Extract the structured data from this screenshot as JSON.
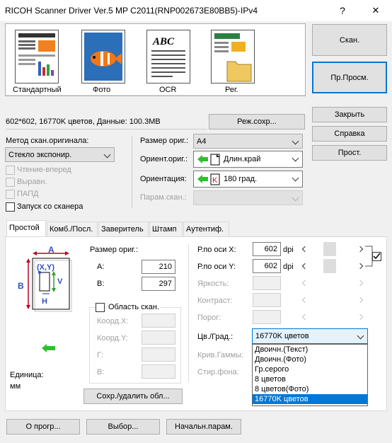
{
  "window": {
    "title": "RICOH Scanner Driver Ver.5 MP C2011(RNP002673E80BB5)-IPv4",
    "help_btn": "?",
    "close_btn": "✕"
  },
  "presets": [
    {
      "label": "Стандартный",
      "icon": "newspaper-icon"
    },
    {
      "label": "Фото",
      "icon": "fish-photo-icon"
    },
    {
      "label": "OCR",
      "icon": "text-document-icon"
    },
    {
      "label": "Рег.",
      "icon": "folder-document-icon"
    }
  ],
  "info_text": "602*602, 16770K цветов, Данные: 100.3MB",
  "save_mode_button": "Реж.сохр...",
  "right_buttons": {
    "scan": "Скан.",
    "preview": "Пр.Просм.",
    "close": "Закрыть",
    "help": "Справка",
    "simple": "Прост."
  },
  "scan_method": {
    "label": "Метод скан.оригинала:",
    "value": "Стекло экспонир."
  },
  "checkboxes": [
    {
      "label": "Чтение-вперед",
      "enabled": false
    },
    {
      "label": "Выравн.",
      "enabled": false
    },
    {
      "label": "ПАПД",
      "enabled": false
    },
    {
      "label": "Запуск со сканера",
      "enabled": true
    }
  ],
  "orig_size": {
    "label": "Размер ориг.:",
    "value": "A4"
  },
  "orig_orient": {
    "label": "Ориент.ориг.:",
    "value": "Длин.край"
  },
  "orientation": {
    "label": "Ориентация:",
    "value": "180 град."
  },
  "scan_param": {
    "label": "Парам.скан.:"
  },
  "tabs": [
    "Простой",
    "Комб./Посл.",
    "Заверитель",
    "Штамп",
    "Аутентиф."
  ],
  "diagram": {
    "a": "A",
    "b": "B",
    "xy": "(X,Y)",
    "v": "V",
    "h": "H"
  },
  "unit": {
    "label": "Единица:",
    "value": "мм"
  },
  "size_section": {
    "title": "Размер ориг.:",
    "a_label": "A:",
    "a_value": "210",
    "b_label": "B:",
    "b_value": "297"
  },
  "scan_area": {
    "label": "Область скан.",
    "x_label": "Коорд.X:",
    "y_label": "Коорд.Y:",
    "g_label": "Г:",
    "v_label": "В:"
  },
  "save_area_button": "Сохр./удалить обл...",
  "res_x": {
    "label": "Р.по оси X:",
    "value": "602",
    "unit": "dpi"
  },
  "res_y": {
    "label": "Р.по оси Y:",
    "value": "602",
    "unit": "dpi"
  },
  "brightness": {
    "label": "Яркость:"
  },
  "contrast": {
    "label": "Контраст:"
  },
  "threshold": {
    "label": "Порог:"
  },
  "color": {
    "label": "Цв./Град.:",
    "value": "16770K цветов"
  },
  "gamma": {
    "label": "Крив.Гаммы:"
  },
  "erase": {
    "label": "Стир.фона:"
  },
  "color_options": [
    "Двоичн.(Текст)",
    "Двоичн.(Фото)",
    "Гр.серого",
    "8 цветов",
    "8 цветов(Фото)",
    "16770K цветов"
  ],
  "bottom_buttons": {
    "about": "О прогр...",
    "select": "Выбор...",
    "defaults": "Начальн.парам."
  }
}
